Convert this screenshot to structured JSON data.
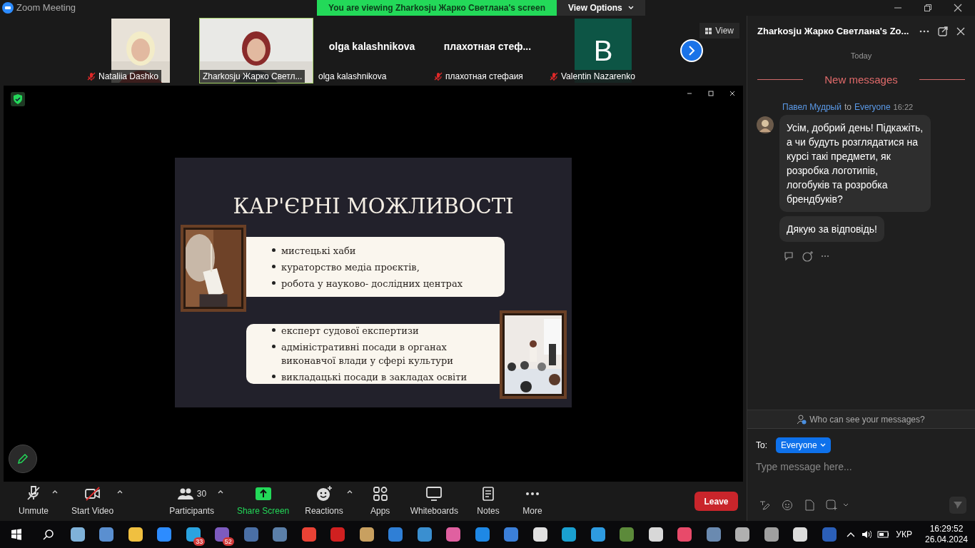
{
  "window": {
    "title": "Zoom Meeting"
  },
  "banner": {
    "text": "You are viewing Zharkosju Жарко Светлана's screen",
    "options": "View Options"
  },
  "participants": [
    {
      "name": "Nataliia Dashko",
      "muted": true,
      "speaking": false,
      "kind": "video"
    },
    {
      "name": "Zharkosju Жарко Светл...",
      "muted": false,
      "speaking": true,
      "kind": "video"
    },
    {
      "name": "olga kalashnikova",
      "muted": false,
      "speaking": false,
      "kind": "name",
      "caption": "olga kalashnikova"
    },
    {
      "name": "плахотная стефаия",
      "muted": true,
      "speaking": false,
      "kind": "name",
      "caption": "плахотная  стеф..."
    },
    {
      "name": "Valentin Nazarenko",
      "muted": true,
      "speaking": false,
      "kind": "avatar",
      "letter": "B"
    }
  ],
  "view_button": "View",
  "slide": {
    "title": "КАР'ЄРНІ МОЖЛИВОСТІ",
    "box1": [
      "мистецькі хаби",
      "кураторство медіа проєктів,",
      "робота у науково- дослідних центрах"
    ],
    "box2": [
      "експерт судової експертизи",
      "адміністративні посади в органах виконавчої влади у сфері культури",
      "викладацькі посади в закладах освіти"
    ]
  },
  "toolbar": [
    {
      "kind": "mic",
      "label": "Unmute",
      "menu": true
    },
    {
      "kind": "video",
      "label": "Start Video",
      "menu": true
    },
    {
      "kind": "participants",
      "label": "Participants",
      "count": "30",
      "menu": true
    },
    {
      "kind": "share",
      "label": "Share Screen",
      "menu": false
    },
    {
      "kind": "reactions",
      "label": "Reactions",
      "menu": true
    },
    {
      "kind": "apps",
      "label": "Apps",
      "menu": false
    },
    {
      "kind": "whiteboards",
      "label": "Whiteboards",
      "menu": false
    },
    {
      "kind": "notes",
      "label": "Notes",
      "menu": false
    },
    {
      "kind": "more",
      "label": "More",
      "menu": false
    }
  ],
  "leave_button": "Leave",
  "chat": {
    "title": "Zharkosju Жарко Светлана's Zo...",
    "day": "Today",
    "divider": "New messages",
    "message": {
      "sender": "Павел Мудрый",
      "to_word": "to",
      "recipient": "Everyone",
      "time": "16:22",
      "bubbles": [
        "Усім, добрий день! Підкажіть, а чи будуть розглядатися на курсі такі предмети, як розробка логотипів, логобуків та розробка брендбуків?",
        "Дякую за відповідь!"
      ]
    },
    "privacy": "Who can see your messages?",
    "to_label": "To:",
    "to_value": "Everyone",
    "placeholder": "Type message here..."
  },
  "taskbar": {
    "apps": [
      {
        "color": "#7fb2d9"
      },
      {
        "color": "#5a8fd0"
      },
      {
        "color": "#f0c040"
      },
      {
        "color": "#2d8cff"
      },
      {
        "color": "#2aa3df",
        "badge": "33"
      },
      {
        "color": "#7d5bbf",
        "badge": "52"
      },
      {
        "color": "#4a6fa5"
      },
      {
        "color": "#5b7fa8"
      },
      {
        "color": "#e94235"
      },
      {
        "color": "#d02020"
      },
      {
        "color": "#c8a060"
      },
      {
        "color": "#2f7fd6"
      },
      {
        "color": "#3a8fd0"
      },
      {
        "color": "#e060a0"
      },
      {
        "color": "#1e88e5"
      },
      {
        "color": "#3b7fd8"
      },
      {
        "color": "#e0e0e0"
      },
      {
        "color": "#1aa0d0"
      },
      {
        "color": "#2e9be0"
      },
      {
        "color": "#5c8a3a"
      },
      {
        "color": "#d8d8d8"
      },
      {
        "color": "#e84a6a"
      },
      {
        "color": "#6a8ab0"
      },
      {
        "color": "#b0b0b0"
      },
      {
        "color": "#a0a0a0"
      },
      {
        "color": "#dcdcdc"
      },
      {
        "color": "#2b5fb8"
      }
    ],
    "language": "УКР",
    "time": "16:29:52",
    "date": "26.04.2024"
  }
}
